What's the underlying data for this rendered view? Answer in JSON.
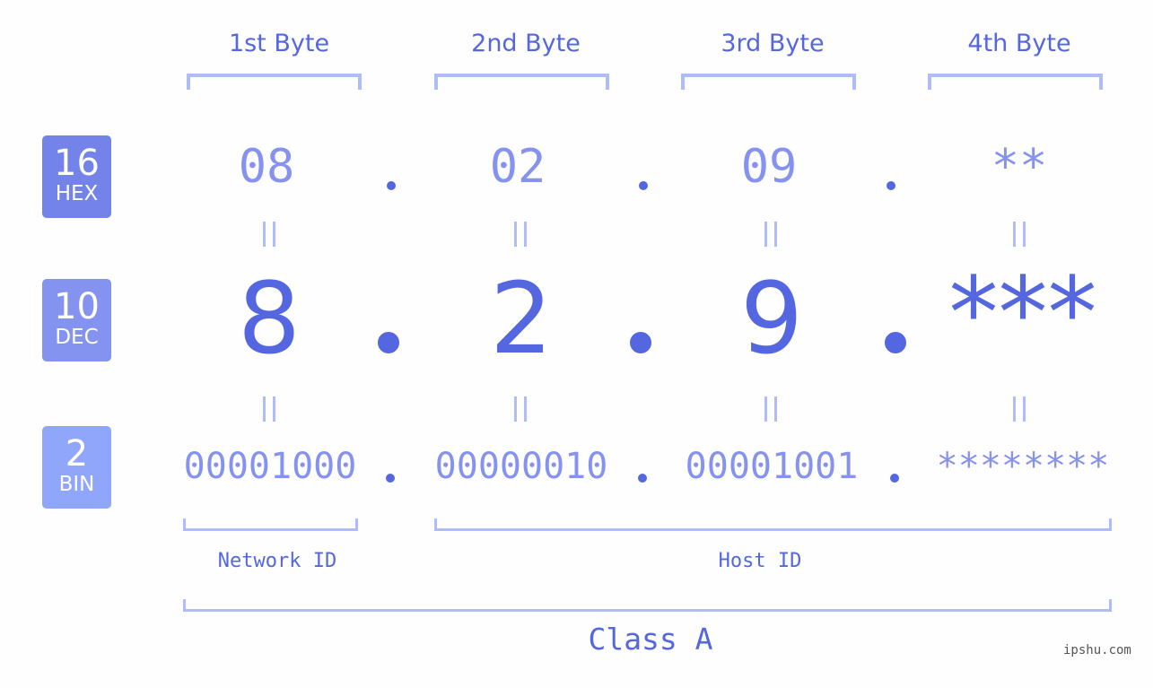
{
  "headers": [
    "1st Byte",
    "2nd Byte",
    "3rd Byte",
    "4th Byte"
  ],
  "badges": [
    {
      "num": "16",
      "label": "HEX",
      "color": "#7483ea"
    },
    {
      "num": "10",
      "label": "DEC",
      "color": "#8593f0"
    },
    {
      "num": "2",
      "label": "BIN",
      "color": "#8fa6fa"
    }
  ],
  "hex": [
    "08",
    "02",
    "09",
    "**"
  ],
  "dec": [
    "8",
    "2",
    "9",
    "***"
  ],
  "bin": [
    "00001000",
    "00000010",
    "00001001",
    "********"
  ],
  "separator": ".",
  "network_id_label": "Network ID",
  "host_id_label": "Host ID",
  "class_label": "Class A",
  "watermark": "ipshu.com",
  "colors": {
    "accent": "#5467e0",
    "value_light": "#8592ef",
    "bracket": "#b0bcf8",
    "background": "#fdfefd"
  }
}
